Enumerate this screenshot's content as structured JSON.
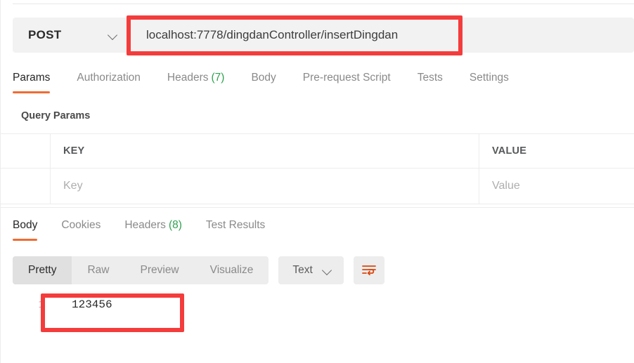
{
  "request": {
    "method": "POST",
    "url": "localhost:7778/dingdanController/insertDingdan",
    "method_dropdown_icon": "chevron-down-icon",
    "tabs": [
      {
        "label": "Params",
        "count": null,
        "active": true
      },
      {
        "label": "Authorization",
        "count": null,
        "active": false
      },
      {
        "label": "Headers",
        "count": "(7)",
        "active": false
      },
      {
        "label": "Body",
        "count": null,
        "active": false
      },
      {
        "label": "Pre-request Script",
        "count": null,
        "active": false
      },
      {
        "label": "Tests",
        "count": null,
        "active": false
      },
      {
        "label": "Settings",
        "count": null,
        "active": false
      }
    ],
    "query_params": {
      "title": "Query Params",
      "headers": {
        "key": "KEY",
        "value": "VALUE"
      },
      "rows": [
        {
          "key_placeholder": "Key",
          "value_placeholder": "Value"
        }
      ]
    }
  },
  "response": {
    "tabs": [
      {
        "label": "Body",
        "count": null,
        "active": true
      },
      {
        "label": "Cookies",
        "count": null,
        "active": false
      },
      {
        "label": "Headers",
        "count": "(8)",
        "active": false
      },
      {
        "label": "Test Results",
        "count": null,
        "active": false
      }
    ],
    "format_bar": {
      "segments": [
        {
          "label": "Pretty",
          "selected": true
        },
        {
          "label": "Raw",
          "selected": false
        },
        {
          "label": "Preview",
          "selected": false
        },
        {
          "label": "Visualize",
          "selected": false
        }
      ],
      "type_value": "Text",
      "type_dropdown_icon": "chevron-down-icon",
      "wrap_icon": "word-wrap-icon"
    },
    "body": {
      "line_number": "1",
      "content": "123456"
    }
  },
  "annotations": {
    "color": "#f43c3c",
    "url_highlight": true,
    "response_highlight": true
  },
  "colors": {
    "accent_orange": "#ef6c34",
    "count_green": "#2fa24f",
    "field_bg": "#f2f2f2",
    "annotation_red": "#f43c3c",
    "wrap_icon_orange": "#d9480f"
  }
}
